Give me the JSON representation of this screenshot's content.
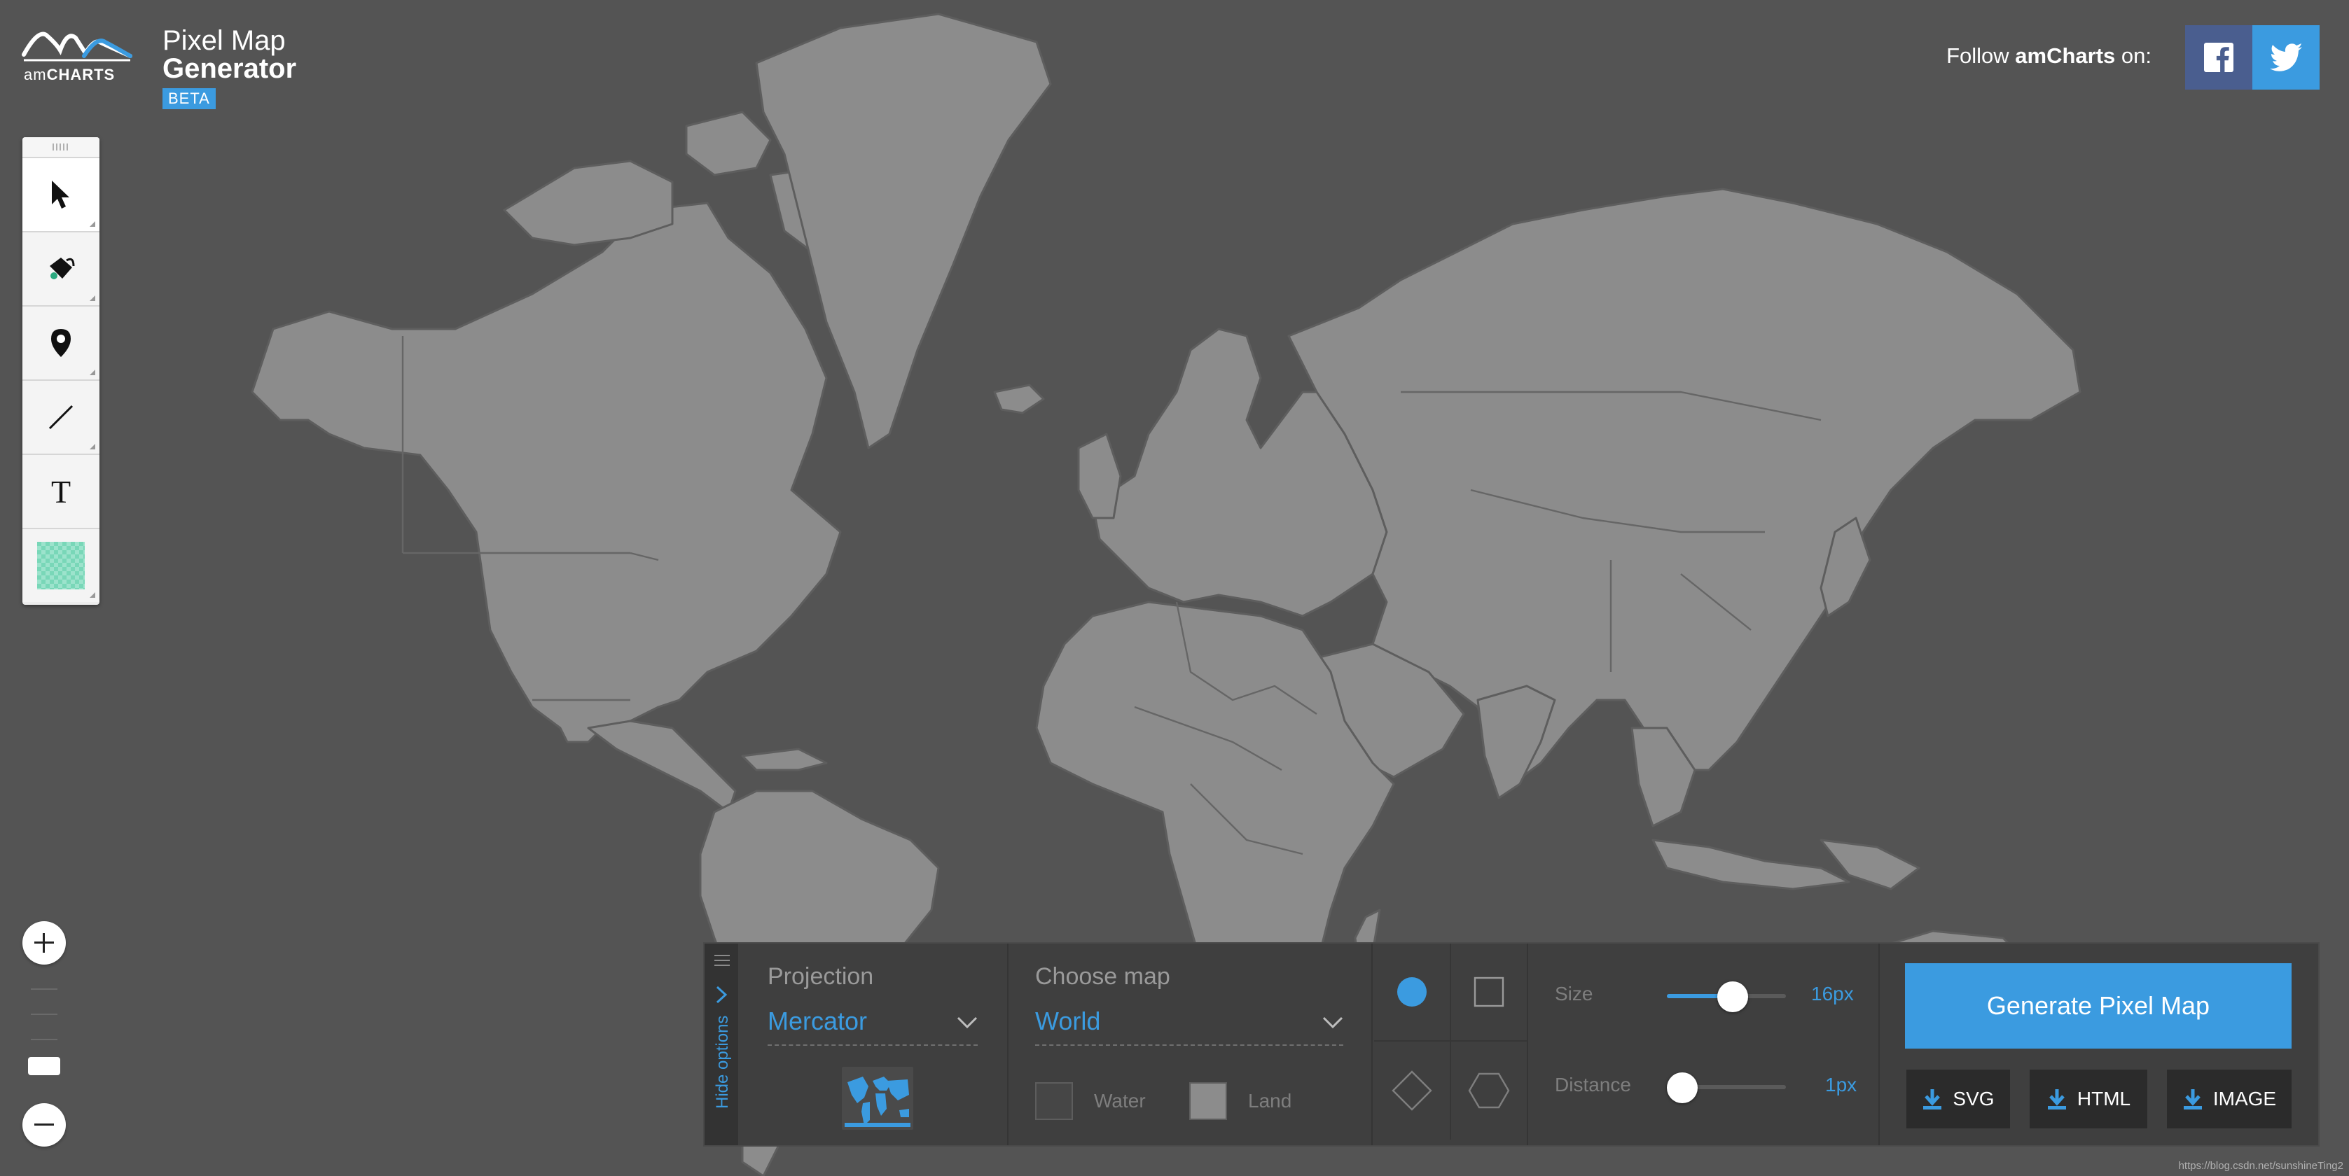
{
  "app": {
    "logo_text_light": "am",
    "logo_text_bold": "CHARTS",
    "title_line1": "Pixel Map",
    "title_line2": "Generator",
    "badge": "BETA"
  },
  "header": {
    "follow_prefix": "Follow ",
    "follow_brand": "amCharts",
    "follow_suffix": " on:",
    "facebook_icon": "facebook-icon",
    "twitter_icon": "twitter-icon"
  },
  "toolbar": {
    "tools": [
      {
        "name": "select-tool",
        "icon": "cursor-arrow-icon",
        "active": true
      },
      {
        "name": "paint-tool",
        "icon": "paint-bucket-icon"
      },
      {
        "name": "marker-tool",
        "icon": "map-pin-icon"
      },
      {
        "name": "line-tool",
        "icon": "line-icon"
      },
      {
        "name": "text-tool",
        "icon": "text-icon",
        "glyph": "T"
      },
      {
        "name": "color-tool",
        "icon": "color-swatch-icon",
        "color": "#79d7b8"
      }
    ]
  },
  "zoom": {
    "in_icon": "plus-icon",
    "out_icon": "minus-icon"
  },
  "options": {
    "hide_label": "Hide options",
    "projection": {
      "title": "Projection",
      "value": "Mercator"
    },
    "map": {
      "title": "Choose map",
      "value": "World"
    },
    "water_label": "Water",
    "land_label": "Land",
    "shapes": [
      "circle",
      "square",
      "diamond",
      "hexagon"
    ],
    "selected_shape": "circle",
    "size": {
      "label": "Size",
      "value": "16px",
      "level": 0.55
    },
    "distance": {
      "label": "Distance",
      "value": "1px",
      "level": 0.0
    }
  },
  "actions": {
    "generate_label": "Generate Pixel Map",
    "svg_label": "SVG",
    "html_label": "HTML",
    "image_label": "IMAGE"
  },
  "footer": {
    "credit": "https://blog.csdn.net/sunshineTing2"
  },
  "colors": {
    "background": "#545454",
    "land": "#8c8c8c",
    "accent": "#3b9be0",
    "facebook": "#4a5e8f",
    "twitter": "#3b9be0"
  }
}
